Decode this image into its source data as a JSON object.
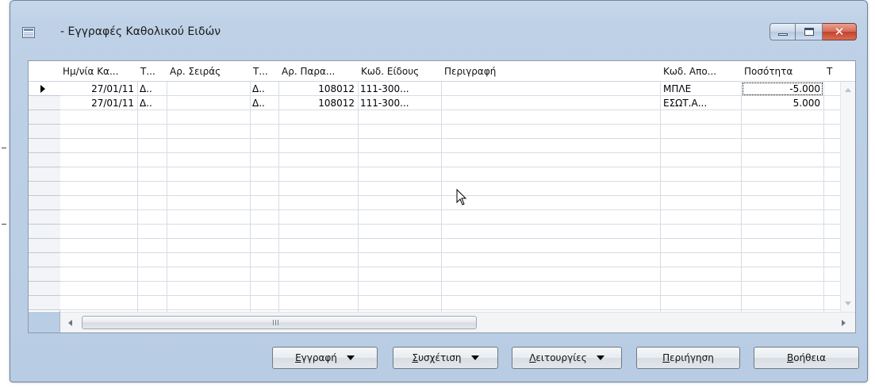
{
  "window": {
    "title": "- Εγγραφές Καθολικού Ειδών",
    "icon": "table-window-icon",
    "controls": {
      "minimize": "minimize-icon",
      "maximize": "maximize-icon",
      "close": "close-icon"
    }
  },
  "grid": {
    "columns": [
      "Ημ/νία Κα...",
      "Τ...",
      "Αρ. Σειράς",
      "Τ...",
      "Αρ. Παρα...",
      "Κωδ. Είδους",
      "Περιγραφή",
      "Κωδ. Απο...",
      "Ποσότητα",
      "Τ"
    ],
    "rows": [
      {
        "date": "27/01/11",
        "t1": "Δ..",
        "serial": "",
        "t2": "Δ..",
        "doc_no": "108012",
        "item_code": "111-300...",
        "description": "",
        "location": "ΜΠΛΕ",
        "quantity": "-5.000"
      },
      {
        "date": "27/01/11",
        "t1": "Δ..",
        "serial": "",
        "t2": "Δ..",
        "doc_no": "108012",
        "item_code": "111-300...",
        "description": "",
        "location": "ΕΣΩΤ.Α...",
        "quantity": "5.000"
      }
    ],
    "scroll_grip": "III"
  },
  "buttons": {
    "entry": "Εγγραφή",
    "relate": "Συσχέτιση",
    "functions": "Λειτουργίες",
    "navigate": "Περιήγηση",
    "help": "Βοήθεια"
  }
}
